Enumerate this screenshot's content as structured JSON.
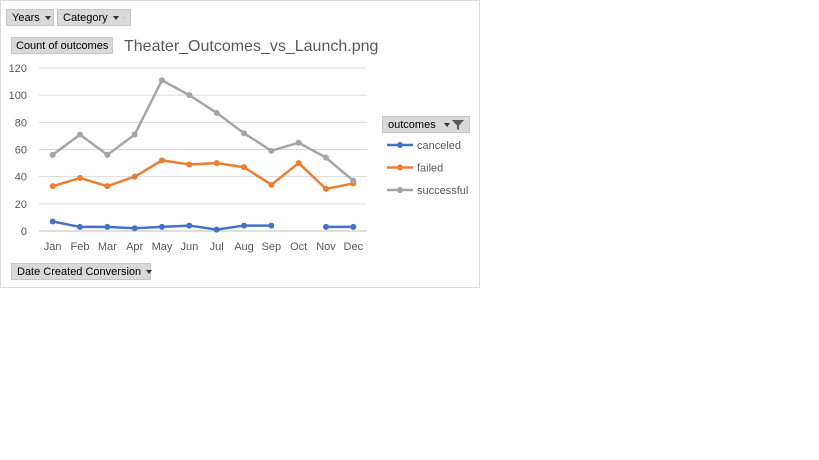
{
  "filters": {
    "years_label": "Years",
    "category_label": "Category",
    "outcomes_label": "outcomes",
    "axis_field_label": "Date Created Conversion"
  },
  "measure_label": "Count of outcomes",
  "chart_data": {
    "type": "line",
    "title": "Theater_Outcomes_vs_Launch.png",
    "xlabel": "",
    "ylabel": "",
    "categories": [
      "Jan",
      "Feb",
      "Mar",
      "Apr",
      "May",
      "Jun",
      "Jul",
      "Aug",
      "Sep",
      "Oct",
      "Nov",
      "Dec"
    ],
    "ylim": [
      0,
      120
    ],
    "yticks": [
      0,
      20,
      40,
      60,
      80,
      100,
      120
    ],
    "grid": true,
    "legend_position": "right",
    "series": [
      {
        "name": "canceled",
        "color": "#4472c4",
        "values": [
          7,
          3,
          3,
          2,
          3,
          4,
          1,
          4,
          4,
          null,
          3,
          3
        ]
      },
      {
        "name": "failed",
        "color": "#ed7d31",
        "values": [
          33,
          39,
          33,
          40,
          52,
          49,
          50,
          47,
          34,
          50,
          31,
          35
        ]
      },
      {
        "name": "successful",
        "color": "#a5a5a5",
        "values": [
          56,
          71,
          56,
          71,
          111,
          100,
          87,
          72,
          59,
          65,
          54,
          37
        ]
      }
    ]
  }
}
